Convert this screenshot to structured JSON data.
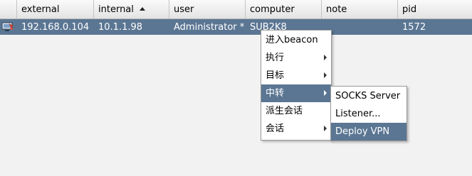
{
  "table": {
    "columns": [
      "external",
      "internal",
      "user",
      "computer",
      "note",
      "pid"
    ],
    "sorted_column": "internal",
    "row": {
      "icon": "session-host-icon",
      "external": "192.168.0.104",
      "internal": "10.1.1.98",
      "user": "Administrator *",
      "computer": "SUB2K8",
      "note": "",
      "pid": "1572"
    }
  },
  "context_menu": {
    "items": [
      {
        "label": "进入beacon",
        "submenu": false
      },
      {
        "label": "执行",
        "submenu": true
      },
      {
        "label": "目标",
        "submenu": true
      },
      {
        "label": "中转",
        "submenu": true,
        "selected": true
      },
      {
        "label": "派生会话",
        "submenu": false
      },
      {
        "label": "会话",
        "submenu": true
      }
    ]
  },
  "pivot_submenu": {
    "items": [
      {
        "label": "SOCKS Server"
      },
      {
        "label": "Listener..."
      },
      {
        "label": "Deploy VPN",
        "selected": true
      }
    ]
  },
  "colors": {
    "selection": "#5b7693",
    "background": "#f2f2f2",
    "header": "#e8e8e8"
  }
}
